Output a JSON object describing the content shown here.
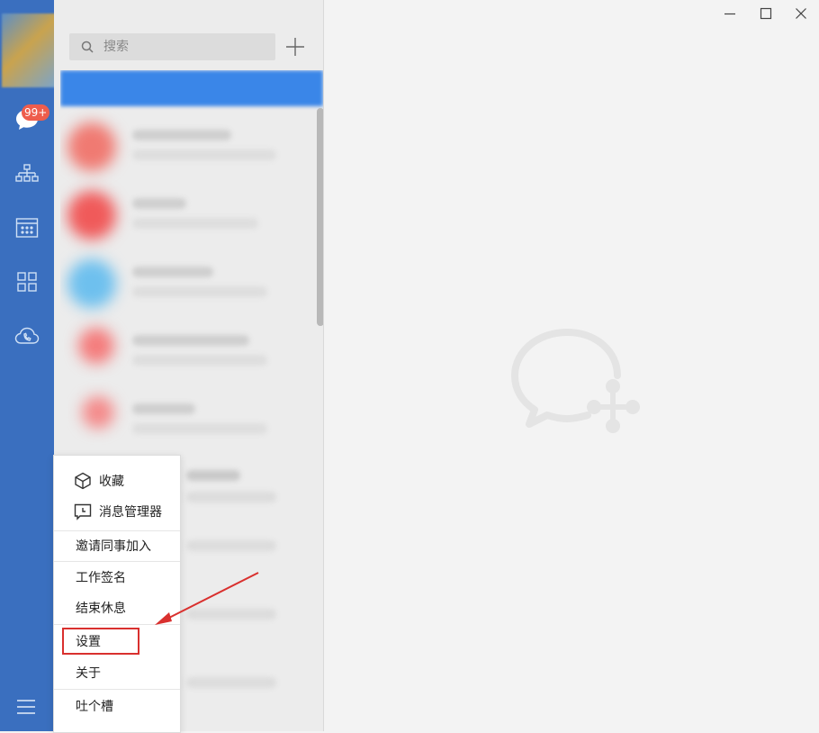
{
  "sidebar": {
    "chat_badge": "99+",
    "nav_icons": [
      "chat-icon",
      "org-chart-icon",
      "calendar-icon",
      "apps-grid-icon",
      "cloud-phone-icon"
    ],
    "menu_icon": "hamburger-menu-icon",
    "accent_color": "#3a6fbf",
    "badge_color": "#ee5d4c"
  },
  "search": {
    "placeholder": "搜索"
  },
  "conversation_list": {
    "selected_color": "#3a86e8"
  },
  "popup_menu": {
    "items": [
      {
        "label": "收藏",
        "icon": "cube-icon"
      },
      {
        "label": "消息管理器",
        "icon": "message-manager-icon"
      },
      {
        "label": "邀请同事加入"
      },
      {
        "label": "工作签名"
      },
      {
        "label": "结束休息"
      },
      {
        "label": "设置",
        "highlighted": true
      },
      {
        "label": "关于"
      },
      {
        "label": "吐个槽"
      }
    ],
    "highlight_color": "#d9302e"
  },
  "window_controls": [
    "minimize-icon",
    "maximize-icon",
    "close-icon"
  ]
}
